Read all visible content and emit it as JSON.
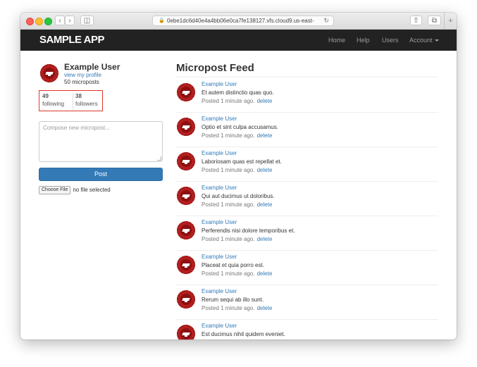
{
  "browser": {
    "url": "0ebe1dc6d40e4a4bb06e0ca7fe138127.vfs.cloud9.us-east-",
    "back_icon": "chevron-left-icon",
    "forward_icon": "chevron-right-icon",
    "sidebar_icon": "sidebar-icon",
    "share_icon": "share-icon",
    "tabs_icon": "tabs-icon",
    "new_tab": "+"
  },
  "navbar": {
    "brand": "SAMPLE APP",
    "links": [
      "Home",
      "Help",
      "Users",
      "Account"
    ]
  },
  "sidebar": {
    "user_name": "Example User",
    "view_profile": "view my profile",
    "microposts_count": "50 microposts",
    "following_count": "49",
    "following_label": "following",
    "followers_count": "38",
    "followers_label": "followers",
    "compose_placeholder": "Compose new micropost...",
    "post_button": "Post",
    "choose_file": "Choose File",
    "no_file": "no file selected"
  },
  "feed": {
    "title": "Micropost Feed",
    "items": [
      {
        "user": "Example User",
        "content": "Et autem distinctio quas quo.",
        "time": "Posted 1 minute ago.",
        "delete": "delete"
      },
      {
        "user": "Example User",
        "content": "Optio et sint culpa accusamus.",
        "time": "Posted 1 minute ago.",
        "delete": "delete"
      },
      {
        "user": "Example User",
        "content": "Laboriosam quas est repellat et.",
        "time": "Posted 1 minute ago.",
        "delete": "delete"
      },
      {
        "user": "Example User",
        "content": "Qui aut ducimus ut doloribus.",
        "time": "Posted 1 minute ago.",
        "delete": "delete"
      },
      {
        "user": "Example User",
        "content": "Perferendis nisi dolore temporibus et.",
        "time": "Posted 1 minute ago.",
        "delete": "delete"
      },
      {
        "user": "Example User",
        "content": "Placeat et quia porro est.",
        "time": "Posted 1 minute ago.",
        "delete": "delete"
      },
      {
        "user": "Example User",
        "content": "Rerum sequi ab illo sunt.",
        "time": "Posted 1 minute ago.",
        "delete": "delete"
      },
      {
        "user": "Example User",
        "content": "Est ducimus nihil quidem eveniet.",
        "time": "",
        "delete": ""
      }
    ]
  },
  "colors": {
    "navbar_bg": "#222222",
    "link": "#337ab7",
    "highlight_box": "#e0372e",
    "avatar": "#b41e1e"
  }
}
